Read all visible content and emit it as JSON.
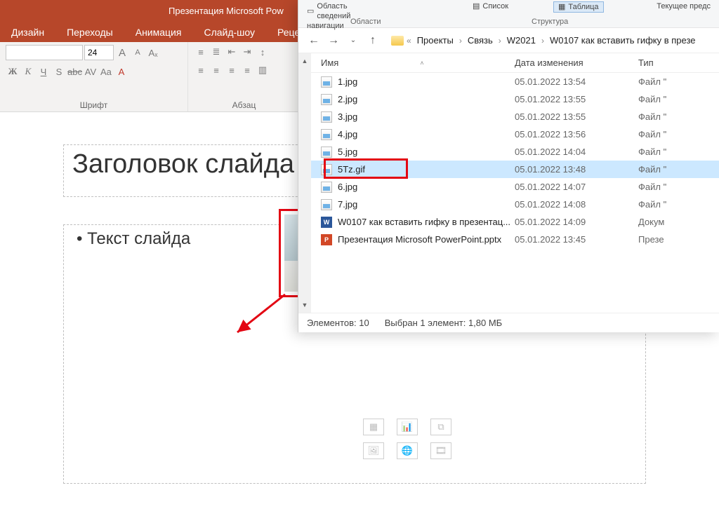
{
  "ppt": {
    "title": "Презентация Microsoft Pow",
    "tabs": [
      "Дизайн",
      "Переходы",
      "Анимация",
      "Слайд-шоу",
      "Рецензи"
    ],
    "font_size_value": "24",
    "group_font": "Шрифт",
    "group_para": "Абзац",
    "fmt": {
      "b": "Ж",
      "i": "К",
      "u": "Ч",
      "s": "S",
      "abc": "abc",
      "av": "AV",
      "aa": "Aa",
      "afont": "A"
    },
    "incA": "A",
    "decA": "A",
    "clear": "Aₓ"
  },
  "slide": {
    "title_text": "Заголовок слайда",
    "body_text": "• Текст слайда"
  },
  "explorer": {
    "ribbon": {
      "nav_line2": "навигации",
      "details": "Область сведений",
      "pane_group": "Области",
      "list": "Список",
      "table": "Таблица",
      "struct_group": "Структура",
      "current_view": "Текущее предс"
    },
    "breadcrumb": [
      "Проекты",
      "Связь",
      "W2021",
      "W0107 как вставить гифку в презе"
    ],
    "columns": {
      "name": "Имя",
      "date": "Дата изменения",
      "type": "Тип"
    },
    "files": [
      {
        "icon": "img",
        "name": "1.jpg",
        "date": "05.01.2022 13:54",
        "type": "Файл \"",
        "sel": false
      },
      {
        "icon": "img",
        "name": "2.jpg",
        "date": "05.01.2022 13:55",
        "type": "Файл \"",
        "sel": false
      },
      {
        "icon": "img",
        "name": "3.jpg",
        "date": "05.01.2022 13:55",
        "type": "Файл \"",
        "sel": false
      },
      {
        "icon": "img",
        "name": "4.jpg",
        "date": "05.01.2022 13:56",
        "type": "Файл \"",
        "sel": false
      },
      {
        "icon": "img",
        "name": "5.jpg",
        "date": "05.01.2022 14:04",
        "type": "Файл \"",
        "sel": false
      },
      {
        "icon": "img",
        "name": "5Tz.gif",
        "date": "05.01.2022 13:48",
        "type": "Файл \"",
        "sel": true
      },
      {
        "icon": "img",
        "name": "6.jpg",
        "date": "05.01.2022 14:07",
        "type": "Файл \"",
        "sel": false
      },
      {
        "icon": "img",
        "name": "7.jpg",
        "date": "05.01.2022 14:08",
        "type": "Файл \"",
        "sel": false
      },
      {
        "icon": "doc",
        "name": "W0107 как вставить гифку в презентац...",
        "date": "05.01.2022 14:09",
        "type": "Докум",
        "sel": false
      },
      {
        "icon": "ppt",
        "name": "Презентация Microsoft PowerPoint.pptx",
        "date": "05.01.2022 13:45",
        "type": "Презе",
        "sel": false
      }
    ],
    "status": {
      "count": "Элементов: 10",
      "selection": "Выбран 1 элемент: 1,80 МБ"
    }
  }
}
